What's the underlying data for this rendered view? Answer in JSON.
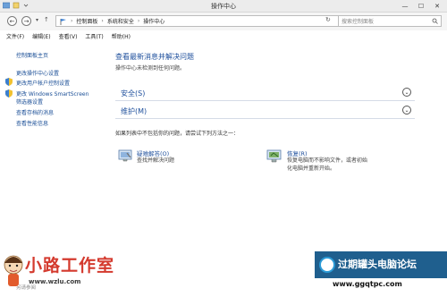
{
  "window": {
    "title": "操作中心",
    "controls": [
      "—",
      "☐",
      "✕"
    ]
  },
  "address": {
    "crumbs": [
      "控制面板",
      "系统和安全",
      "操作中心"
    ],
    "search_placeholder": "搜索控制面板"
  },
  "menu": [
    "文件(F)",
    "编辑(E)",
    "查看(V)",
    "工具(T)",
    "帮助(H)"
  ],
  "sidebar": {
    "home": "控制面板主页",
    "links": [
      "更改操作中心设置",
      "更改用户帐户控制设置",
      "更改 Windows SmartScreen",
      "筛选器设置",
      "查看存档的消息",
      "查看性能信息"
    ],
    "see_also": "另请参阅"
  },
  "main": {
    "title": "查看最新消息并解决问题",
    "subtitle": "操作中心未检测到任何问题。",
    "sections": [
      "安全(S)",
      "维护(M)"
    ],
    "prompt": "如果列表中不包括你的问题，请尝试下列方法之一：",
    "options": [
      {
        "title": "疑难解答(O)",
        "desc": [
          "查找并解决问题"
        ]
      },
      {
        "title": "恢复(R)",
        "desc": [
          "恢复电脑而不影响文件，或者初始",
          "化电脑并重新开始。"
        ]
      }
    ]
  },
  "watermarks": {
    "left_title": "小路工作室",
    "left_url": "www.wzlu.com",
    "right_title": "过期罐头电脑论坛",
    "right_url": "www.ggqtpc.com"
  },
  "colors": {
    "link": "#1a4e96",
    "heading": "#1e4f9c",
    "accent_watermark": "#d43a2e",
    "banner": "#1f5f8e"
  }
}
